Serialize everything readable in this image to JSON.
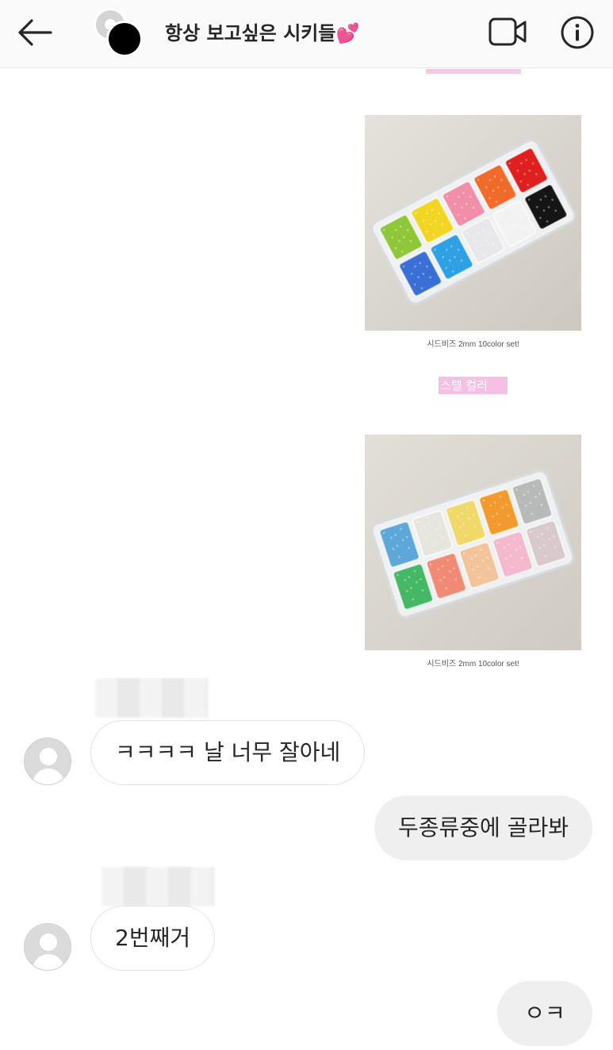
{
  "header": {
    "title": "항상 보고싶은 시키들",
    "title_emoji": "💕"
  },
  "images": [
    {
      "caption": "시드비즈 2mm 10color set!",
      "bead_colors": [
        "#8fc63a",
        "#f2d623",
        "#f28fa8",
        "#f06a2a",
        "#e0201e",
        "#3a6fd6",
        "#2ea0e3",
        "#e8e8ea",
        "#f2f2f2",
        "#151515"
      ]
    },
    {
      "caption": "시드비즈 2mm 10color set!",
      "bead_colors": [
        "#5da8d8",
        "#e6e6dc",
        "#f1d86a",
        "#f39a2e",
        "#b7bab8",
        "#45b866",
        "#f08a74",
        "#f3c49a",
        "#f4b9cc",
        "#d9c8cc"
      ]
    }
  ],
  "pastel_label": "스텔 컬러",
  "messages": [
    {
      "direction": "in",
      "text": "ㅋㅋㅋㅋ 날 너무 잘아네"
    },
    {
      "direction": "out",
      "text": "두종류중에 골라봐"
    },
    {
      "direction": "in",
      "text": "2번째거"
    },
    {
      "direction": "out",
      "text": "ㅇㅋ"
    }
  ]
}
